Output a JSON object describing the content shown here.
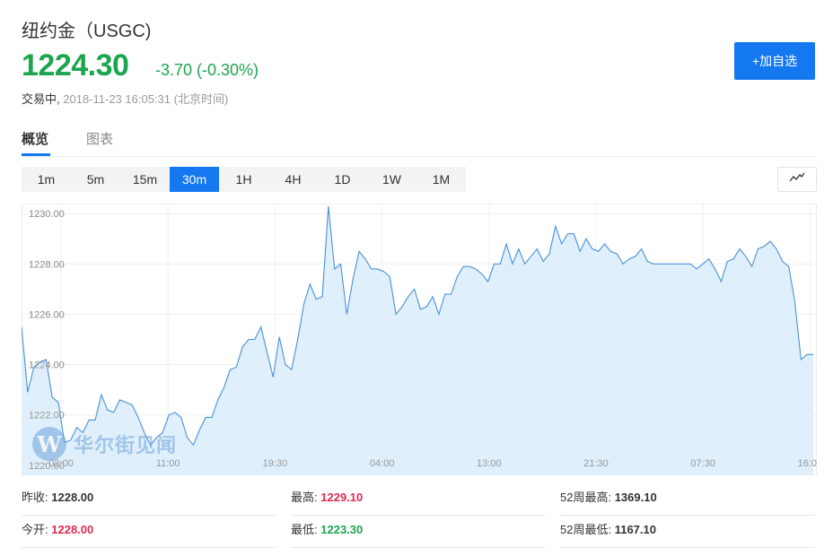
{
  "header": {
    "title": "纽约金（USGC)",
    "price": "1224.30",
    "change": "-3.70 (-0.30%)",
    "status_label": "交易中,",
    "timestamp": "2018-11-23 16:05:31 (北京时间)",
    "add_watchlist_label": "+加自选",
    "accent_color": "#1478f0",
    "down_color": "#1ba54e",
    "up_color": "#e02a50"
  },
  "tabs": [
    {
      "label": "概览",
      "active": true
    },
    {
      "label": "图表",
      "active": false
    }
  ],
  "periods": [
    {
      "label": "1m",
      "active": false
    },
    {
      "label": "5m",
      "active": false
    },
    {
      "label": "15m",
      "active": false
    },
    {
      "label": "30m",
      "active": true
    },
    {
      "label": "1H",
      "active": false
    },
    {
      "label": "4H",
      "active": false
    },
    {
      "label": "1D",
      "active": false
    },
    {
      "label": "1W",
      "active": false
    },
    {
      "label": "1M",
      "active": false
    }
  ],
  "chart_type_icon": "line-chart-icon",
  "watermark": {
    "logo_letter": "W",
    "text": "华尔街见闻"
  },
  "chart_data": {
    "type": "area",
    "ylim": [
      1219.6,
      1230.4
    ],
    "yticks": [
      "1220.00",
      "1222.00",
      "1224.00",
      "1226.00",
      "1228.00",
      "1230.00"
    ],
    "xticks": [
      "02:00",
      "11:00",
      "19:30",
      "04:00",
      "13:00",
      "21:30",
      "07:30",
      "16:00"
    ],
    "grid": true,
    "line_color": "#4a90d9",
    "fill_color": "#dcedfb",
    "values": [
      1225.5,
      1222.9,
      1223.9,
      1224.1,
      1224.2,
      1222.7,
      1222.5,
      1220.9,
      1221.0,
      1221.5,
      1221.3,
      1221.8,
      1221.8,
      1222.8,
      1222.2,
      1222.1,
      1222.6,
      1222.5,
      1222.4,
      1221.9,
      1221.3,
      1220.8,
      1221.1,
      1221.3,
      1222.0,
      1222.1,
      1221.9,
      1221.1,
      1220.8,
      1221.4,
      1221.9,
      1221.9,
      1222.6,
      1223.1,
      1223.8,
      1223.9,
      1224.7,
      1225.0,
      1225.0,
      1225.5,
      1224.5,
      1223.5,
      1225.1,
      1224.0,
      1223.8,
      1225.0,
      1226.4,
      1227.2,
      1226.6,
      1226.7,
      1230.3,
      1227.8,
      1228.0,
      1226.0,
      1227.4,
      1228.5,
      1228.2,
      1227.8,
      1227.8,
      1227.7,
      1227.5,
      1226.0,
      1226.3,
      1226.7,
      1227.0,
      1226.2,
      1226.3,
      1226.7,
      1226.0,
      1226.8,
      1226.8,
      1227.5,
      1227.9,
      1227.9,
      1227.8,
      1227.6,
      1227.3,
      1228.0,
      1228.0,
      1228.8,
      1228.0,
      1228.6,
      1228.0,
      1228.3,
      1228.6,
      1228.1,
      1228.4,
      1229.5,
      1228.8,
      1229.2,
      1229.2,
      1228.5,
      1229.0,
      1228.6,
      1228.5,
      1228.8,
      1228.5,
      1228.4,
      1228.0,
      1228.2,
      1228.3,
      1228.6,
      1228.1,
      1228.0,
      1228.0,
      1228.0,
      1228.0,
      1228.0,
      1228.0,
      1228.0,
      1227.8,
      1228.0,
      1228.2,
      1227.8,
      1227.3,
      1228.1,
      1228.2,
      1228.6,
      1228.3,
      1227.9,
      1228.6,
      1228.7,
      1228.9,
      1228.6,
      1228.1,
      1227.9,
      1226.5,
      1224.2,
      1224.4,
      1224.4
    ]
  },
  "stats": [
    {
      "label": "昨收:",
      "value": "1228.00",
      "tone": "dark"
    },
    {
      "label": "最高:",
      "value": "1229.10",
      "tone": "red"
    },
    {
      "label": "52周最高:",
      "value": "1369.10",
      "tone": "dark"
    },
    {
      "label": "今开:",
      "value": "1228.00",
      "tone": "red"
    },
    {
      "label": "最低:",
      "value": "1223.30",
      "tone": "green"
    },
    {
      "label": "52周最低:",
      "value": "1167.10",
      "tone": "dark"
    }
  ]
}
